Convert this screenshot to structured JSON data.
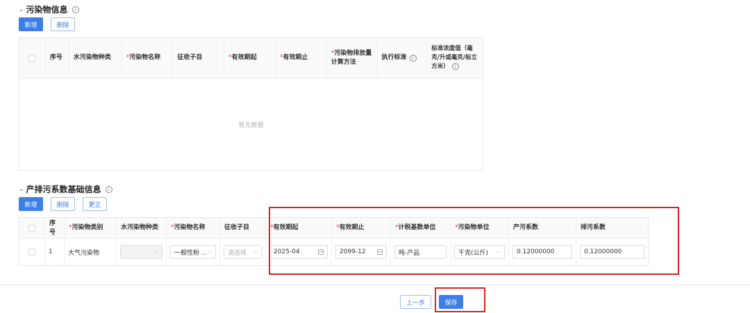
{
  "pollutant_info": {
    "title": "污染物信息",
    "buttons": {
      "add": "新增",
      "delete": "删除"
    },
    "columns": [
      "序号",
      "水污染物种类",
      "污染物名称",
      "征收子目",
      "有效期起",
      "有效期止",
      "污染物排放量计算方法",
      "执行标准",
      "标准浓度值（毫克/升或毫克/标立方米）"
    ],
    "required_marks": "*",
    "empty_text": "暂无数据"
  },
  "emission_factor": {
    "title": "产排污系数基础信息",
    "buttons": {
      "add": "新增",
      "delete": "删除",
      "correct": "更正"
    },
    "columns": [
      "序号",
      "污染物类别",
      "水污染物种类",
      "污染物名称",
      "征收子目",
      "有效期起",
      "有效期止",
      "计税基数单位",
      "污染物单位",
      "产污系数",
      "排污系数"
    ],
    "row": {
      "index": "1",
      "category": "大气污染物",
      "water_type": "",
      "pollutant_name": "一般性粉 ...",
      "sub_item_placeholder": "请选择",
      "valid_from": "2025-04",
      "valid_to": "2099-12",
      "tax_base_unit": "吨-产品",
      "pollutant_unit": "千克(公斤)",
      "production_factor": "0.12000000",
      "discharge_factor": "0.12000000"
    }
  },
  "footer": {
    "prev": "上一步",
    "save": "保存"
  },
  "colors": {
    "primary": "#3d7fe6",
    "highlight": "#e02020",
    "required": "#e53935"
  }
}
